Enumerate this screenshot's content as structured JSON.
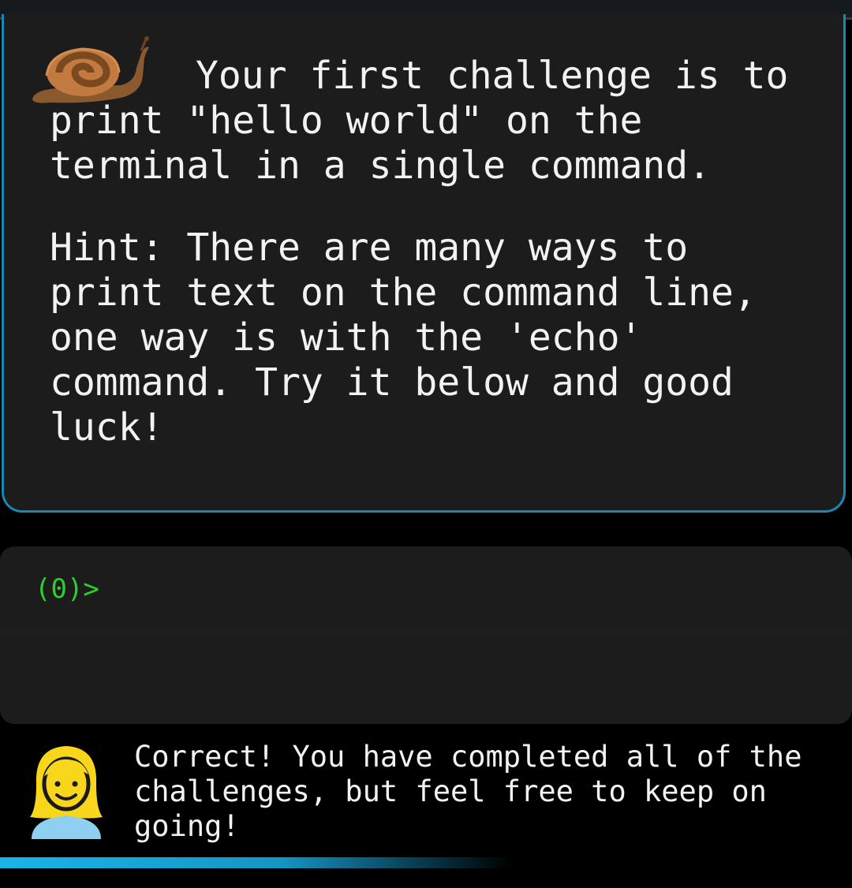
{
  "challenge": {
    "text": "Your first challenge is to print \"hello world\" on the terminal in a single command.",
    "hint": "Hint: There are many ways to print text on the command line, one way is with the 'echo' command. Try it below and good luck!"
  },
  "terminal": {
    "prompt": "(0)>",
    "prompt_color": "#2cd12c",
    "input_value": ""
  },
  "feedback": {
    "text": "Correct! You have completed all of the challenges, but feel free to keep on going!"
  },
  "progress": {
    "fraction": 0.6,
    "color": "#19b5e8"
  },
  "colors": {
    "card_border": "#1a86b3",
    "card_background": "#1c1c1c",
    "page_background": "#000000"
  },
  "icons": {
    "top": "snail-icon",
    "bottom": "woman-avatar-icon"
  }
}
